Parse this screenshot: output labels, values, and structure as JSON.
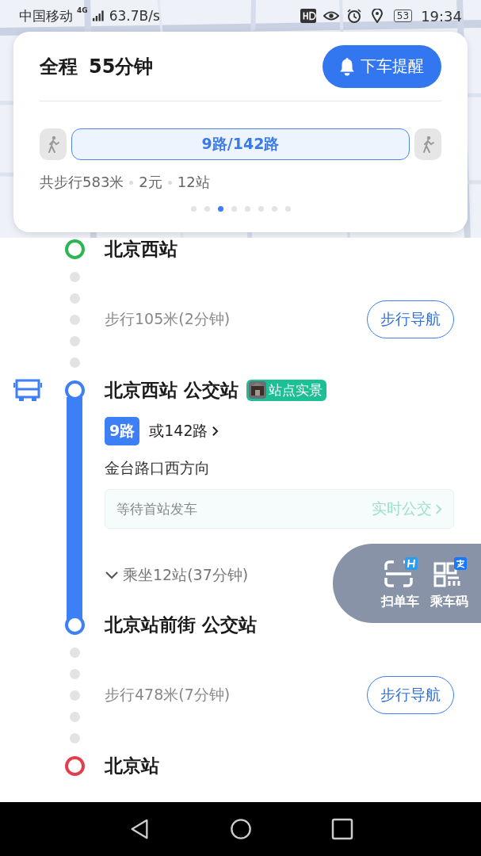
{
  "status_bar": {
    "carrier": "中国移动",
    "network": "4G",
    "speed": "63.7B/s",
    "battery": "53",
    "time": "19:34"
  },
  "summary": {
    "label": "全程",
    "duration": "55分钟",
    "remind_button": "下车提醒",
    "segments": [
      {
        "kind": "walk"
      },
      {
        "kind": "bus",
        "label": "9路/142路",
        "selected": true
      },
      {
        "kind": "walk"
      }
    ],
    "meta": [
      "共步行583米",
      "2元",
      "12站"
    ],
    "pages": [
      {
        "selected": false
      },
      {
        "selected": false
      },
      {
        "selected": true
      },
      {
        "selected": false
      },
      {
        "selected": false
      },
      {
        "selected": false
      },
      {
        "selected": false
      },
      {
        "selected": false
      }
    ]
  },
  "steps": [
    {
      "kind": "stop",
      "name": "北京西站",
      "color": "#2db553"
    },
    {
      "kind": "walk",
      "text": "步行105米(2分钟)",
      "button": "步行导航"
    },
    {
      "kind": "board",
      "name": "北京西站 公交站",
      "color": "#3d7ff5",
      "badge": "站点实景",
      "line": "9路",
      "alt": "或142路",
      "direction": "金台路口西方向",
      "status": "等待首站发车",
      "realtime": "实时公交",
      "ride": "乘坐12站(37分钟)",
      "expanded": false
    },
    {
      "kind": "alight",
      "name": "北京站前街 公交站",
      "color": "#3d7ff5"
    },
    {
      "kind": "walk",
      "text": "步行478米(7分钟)",
      "button": "步行导航"
    },
    {
      "kind": "stop",
      "name": "北京站",
      "color": "#e0404e"
    }
  ],
  "floating": [
    {
      "kind": "bike",
      "label": "扫单车"
    },
    {
      "kind": "qr",
      "label": "乘车码"
    }
  ]
}
